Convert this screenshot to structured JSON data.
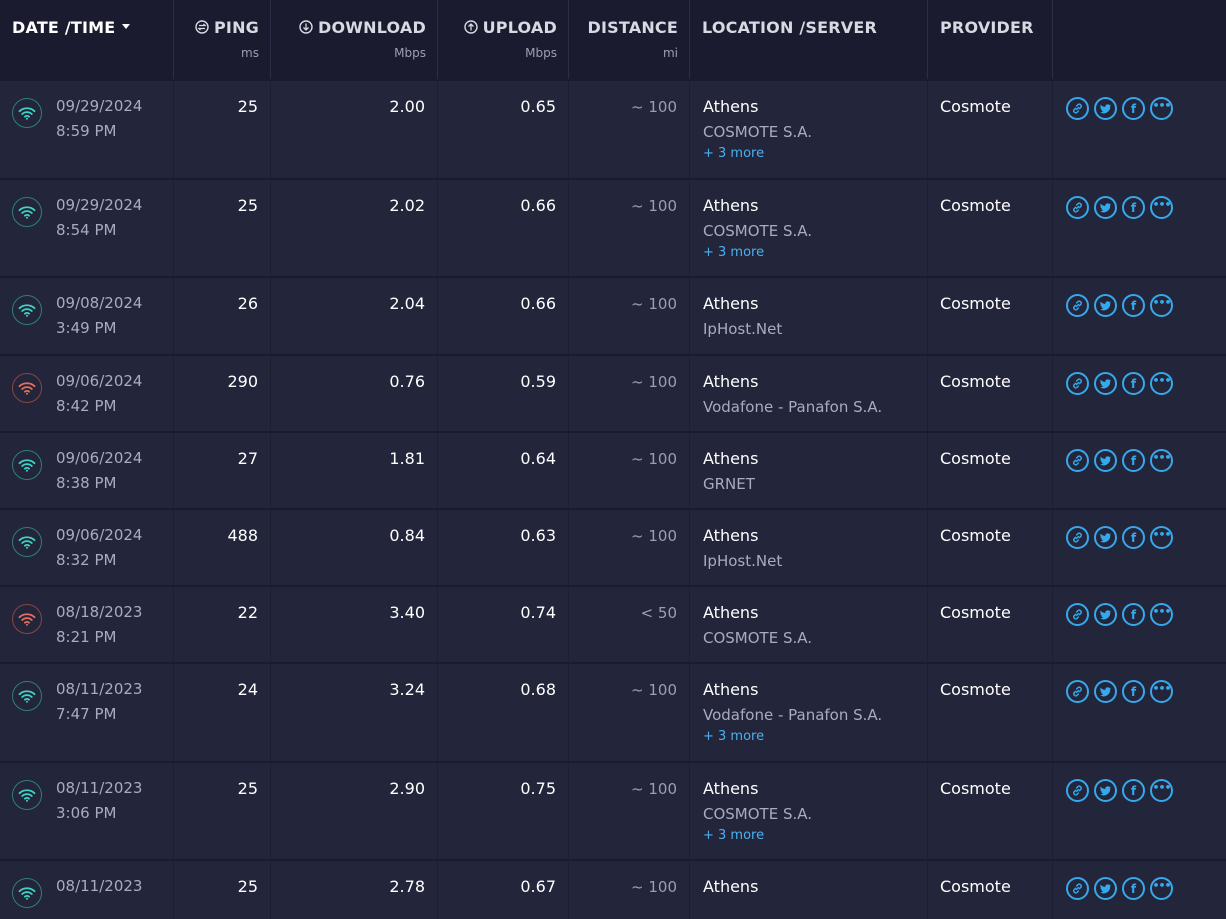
{
  "header": {
    "date": {
      "title": "DATE /TIME"
    },
    "ping": {
      "title": "PING",
      "unit": "ms"
    },
    "download": {
      "title": "DOWNLOAD",
      "unit": "Mbps"
    },
    "upload": {
      "title": "UPLOAD",
      "unit": "Mbps"
    },
    "distance": {
      "title": "DISTANCE",
      "unit": "mi"
    },
    "location": {
      "title": "LOCATION /SERVER"
    },
    "provider": {
      "title": "PROVIDER"
    }
  },
  "colors": {
    "good": "#3fd5c6",
    "bad": "#e8705a",
    "accent": "#36a8ec"
  },
  "rows": [
    {
      "signal": "good",
      "date": "09/29/2024",
      "time": "8:59 PM",
      "ping": "25",
      "download": "2.00",
      "upload": "0.65",
      "distance": "~ 100",
      "city": "Athens",
      "server": "COSMOTE S.A.",
      "more": "+ 3 more",
      "provider": "Cosmote"
    },
    {
      "signal": "good",
      "date": "09/29/2024",
      "time": "8:54 PM",
      "ping": "25",
      "download": "2.02",
      "upload": "0.66",
      "distance": "~ 100",
      "city": "Athens",
      "server": "COSMOTE S.A.",
      "more": "+ 3 more",
      "provider": "Cosmote"
    },
    {
      "signal": "good",
      "date": "09/08/2024",
      "time": "3:49 PM",
      "ping": "26",
      "download": "2.04",
      "upload": "0.66",
      "distance": "~ 100",
      "city": "Athens",
      "server": "IpHost.Net",
      "more": "",
      "provider": "Cosmote"
    },
    {
      "signal": "bad",
      "date": "09/06/2024",
      "time": "8:42 PM",
      "ping": "290",
      "download": "0.76",
      "upload": "0.59",
      "distance": "~ 100",
      "city": "Athens",
      "server": "Vodafone - Panafon S.A.",
      "more": "",
      "provider": "Cosmote"
    },
    {
      "signal": "good",
      "date": "09/06/2024",
      "time": "8:38 PM",
      "ping": "27",
      "download": "1.81",
      "upload": "0.64",
      "distance": "~ 100",
      "city": "Athens",
      "server": "GRNET",
      "more": "",
      "provider": "Cosmote"
    },
    {
      "signal": "good",
      "date": "09/06/2024",
      "time": "8:32 PM",
      "ping": "488",
      "download": "0.84",
      "upload": "0.63",
      "distance": "~ 100",
      "city": "Athens",
      "server": "IpHost.Net",
      "more": "",
      "provider": "Cosmote"
    },
    {
      "signal": "bad",
      "date": "08/18/2023",
      "time": "8:21 PM",
      "ping": "22",
      "download": "3.40",
      "upload": "0.74",
      "distance": "< 50",
      "city": "Athens",
      "server": "COSMOTE S.A.",
      "more": "",
      "provider": "Cosmote"
    },
    {
      "signal": "good",
      "date": "08/11/2023",
      "time": "7:47 PM",
      "ping": "24",
      "download": "3.24",
      "upload": "0.68",
      "distance": "~ 100",
      "city": "Athens",
      "server": "Vodafone - Panafon S.A.",
      "more": "+ 3 more",
      "provider": "Cosmote"
    },
    {
      "signal": "good",
      "date": "08/11/2023",
      "time": "3:06 PM",
      "ping": "25",
      "download": "2.90",
      "upload": "0.75",
      "distance": "~ 100",
      "city": "Athens",
      "server": "COSMOTE S.A.",
      "more": "+ 3 more",
      "provider": "Cosmote"
    },
    {
      "signal": "good",
      "date": "08/11/2023",
      "time": "",
      "ping": "25",
      "download": "2.78",
      "upload": "0.67",
      "distance": "~ 100",
      "city": "Athens",
      "server": "",
      "more": "",
      "provider": "Cosmote"
    }
  ]
}
